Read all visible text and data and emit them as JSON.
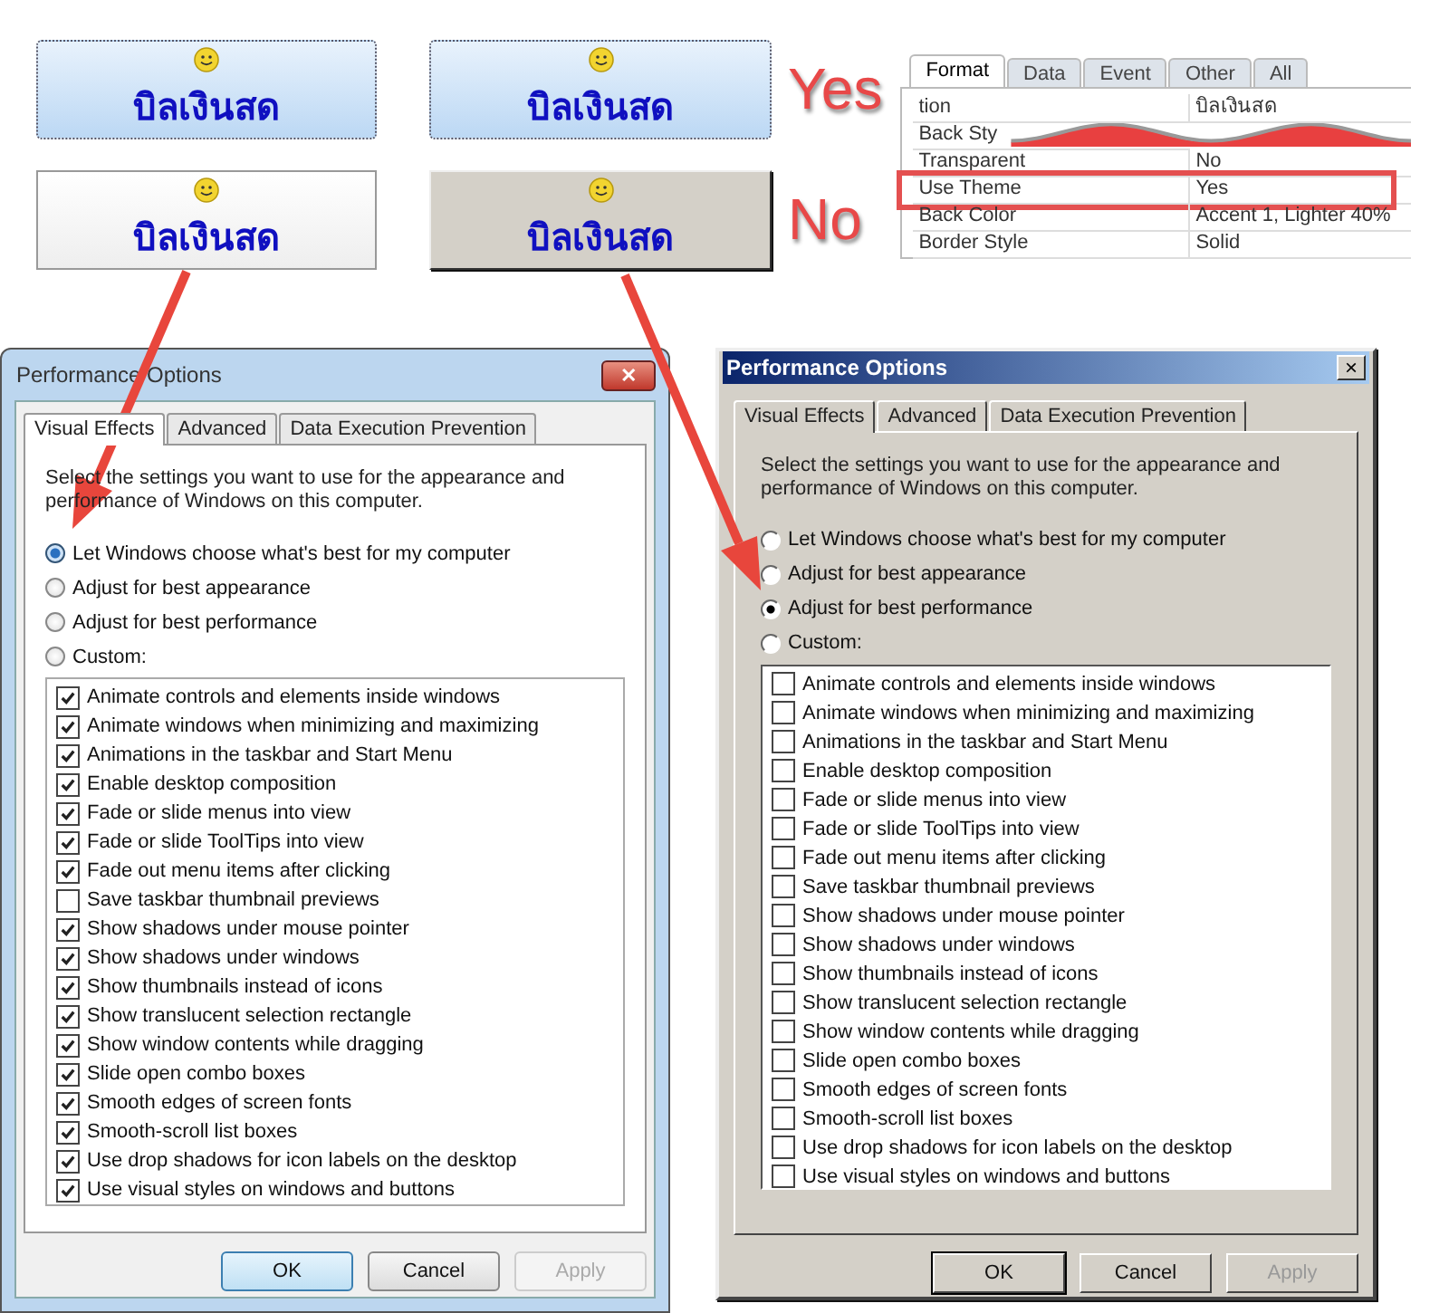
{
  "comparison": {
    "rows": [
      {
        "tag": "Yes",
        "buttons": [
          {
            "kind": "themed",
            "label": "บิลเงินสด"
          },
          {
            "kind": "themed",
            "label": "บิลเงินสด"
          }
        ]
      },
      {
        "tag": "No",
        "buttons": [
          {
            "kind": "plain",
            "label": "บิลเงินสด"
          },
          {
            "kind": "classic",
            "label": "บิลเงินสด"
          }
        ]
      }
    ]
  },
  "property_sheet": {
    "tabs": [
      {
        "label": "Format",
        "selected": true
      },
      {
        "label": "Data",
        "selected": false
      },
      {
        "label": "Event",
        "selected": false
      },
      {
        "label": "Other",
        "selected": false
      },
      {
        "label": "All",
        "selected": false
      }
    ],
    "rows": [
      {
        "name": "tion",
        "value": "บิลเงินสด",
        "highlighted": false
      },
      {
        "name": "Back Sty",
        "highlighted": false
      },
      {
        "name": "Transparent",
        "value": "No",
        "highlighted": false
      },
      {
        "name": "Use Theme",
        "value": "Yes",
        "highlighted": true
      },
      {
        "name": "Back Color",
        "value": "Accent 1, Lighter 40%",
        "highlighted": false
      },
      {
        "name": "Border Style",
        "value": "Solid",
        "highlighted": false
      }
    ]
  },
  "dialogs": [
    {
      "kind": "aero",
      "title": "Performance Options",
      "close": "✕",
      "tabs": [
        {
          "label": "Visual Effects",
          "selected": true
        },
        {
          "label": "Advanced",
          "selected": false
        },
        {
          "label": "Data Execution Prevention",
          "selected": false
        }
      ],
      "intro": "Select the settings you want to use for the appearance and performance of Windows on this computer.",
      "radios": [
        {
          "label": "Let Windows choose what's best for my computer",
          "selected": true
        },
        {
          "label": "Adjust for best appearance",
          "selected": false
        },
        {
          "label": "Adjust for best performance",
          "selected": false
        },
        {
          "label": "Custom:",
          "selected": false
        }
      ],
      "effects": [
        {
          "label": "Animate controls and elements inside windows",
          "checked": true
        },
        {
          "label": "Animate windows when minimizing and maximizing",
          "checked": true
        },
        {
          "label": "Animations in the taskbar and Start Menu",
          "checked": true
        },
        {
          "label": "Enable desktop composition",
          "checked": true
        },
        {
          "label": "Fade or slide menus into view",
          "checked": true
        },
        {
          "label": "Fade or slide ToolTips into view",
          "checked": true
        },
        {
          "label": "Fade out menu items after clicking",
          "checked": true
        },
        {
          "label": "Save taskbar thumbnail previews",
          "checked": false
        },
        {
          "label": "Show shadows under mouse pointer",
          "checked": true
        },
        {
          "label": "Show shadows under windows",
          "checked": true
        },
        {
          "label": "Show thumbnails instead of icons",
          "checked": true
        },
        {
          "label": "Show translucent selection rectangle",
          "checked": true
        },
        {
          "label": "Show window contents while dragging",
          "checked": true
        },
        {
          "label": "Slide open combo boxes",
          "checked": true
        },
        {
          "label": "Smooth edges of screen fonts",
          "checked": true
        },
        {
          "label": "Smooth-scroll list boxes",
          "checked": true
        },
        {
          "label": "Use drop shadows for icon labels on the desktop",
          "checked": true
        },
        {
          "label": "Use visual styles on windows and buttons",
          "checked": true
        }
      ],
      "buttons": [
        {
          "label": "OK",
          "disabled": false
        },
        {
          "label": "Cancel",
          "disabled": false
        },
        {
          "label": "Apply",
          "disabled": true
        }
      ]
    },
    {
      "kind": "classic",
      "title": "Performance Options",
      "close": "×",
      "tabs": [
        {
          "label": "Visual Effects",
          "selected": true
        },
        {
          "label": "Advanced",
          "selected": false
        },
        {
          "label": "Data Execution Prevention",
          "selected": false
        }
      ],
      "intro": "Select the settings you want to use for the appearance and performance of Windows on this computer.",
      "radios": [
        {
          "label": "Let Windows choose what's best for my computer",
          "selected": false
        },
        {
          "label": "Adjust for best appearance",
          "selected": false
        },
        {
          "label": "Adjust for best performance",
          "selected": true
        },
        {
          "label": "Custom:",
          "selected": false
        }
      ],
      "effects": [
        {
          "label": "Animate controls and elements inside windows",
          "checked": false
        },
        {
          "label": "Animate windows when minimizing and maximizing",
          "checked": false
        },
        {
          "label": "Animations in the taskbar and Start Menu",
          "checked": false
        },
        {
          "label": "Enable desktop composition",
          "checked": false
        },
        {
          "label": "Fade or slide menus into view",
          "checked": false
        },
        {
          "label": "Fade or slide ToolTips into view",
          "checked": false
        },
        {
          "label": "Fade out menu items after clicking",
          "checked": false
        },
        {
          "label": "Save taskbar thumbnail previews",
          "checked": false
        },
        {
          "label": "Show shadows under mouse pointer",
          "checked": false
        },
        {
          "label": "Show shadows under windows",
          "checked": false
        },
        {
          "label": "Show thumbnails instead of icons",
          "checked": false
        },
        {
          "label": "Show translucent selection rectangle",
          "checked": false
        },
        {
          "label": "Show window contents while dragging",
          "checked": false
        },
        {
          "label": "Slide open combo boxes",
          "checked": false
        },
        {
          "label": "Smooth edges of screen fonts",
          "checked": false
        },
        {
          "label": "Smooth-scroll list boxes",
          "checked": false
        },
        {
          "label": "Use drop shadows for icon labels on the desktop",
          "checked": false
        },
        {
          "label": "Use visual styles on windows and buttons",
          "checked": false
        }
      ],
      "buttons": [
        {
          "label": "OK",
          "disabled": false
        },
        {
          "label": "Cancel",
          "disabled": false
        },
        {
          "label": "Apply",
          "disabled": true
        }
      ]
    }
  ]
}
